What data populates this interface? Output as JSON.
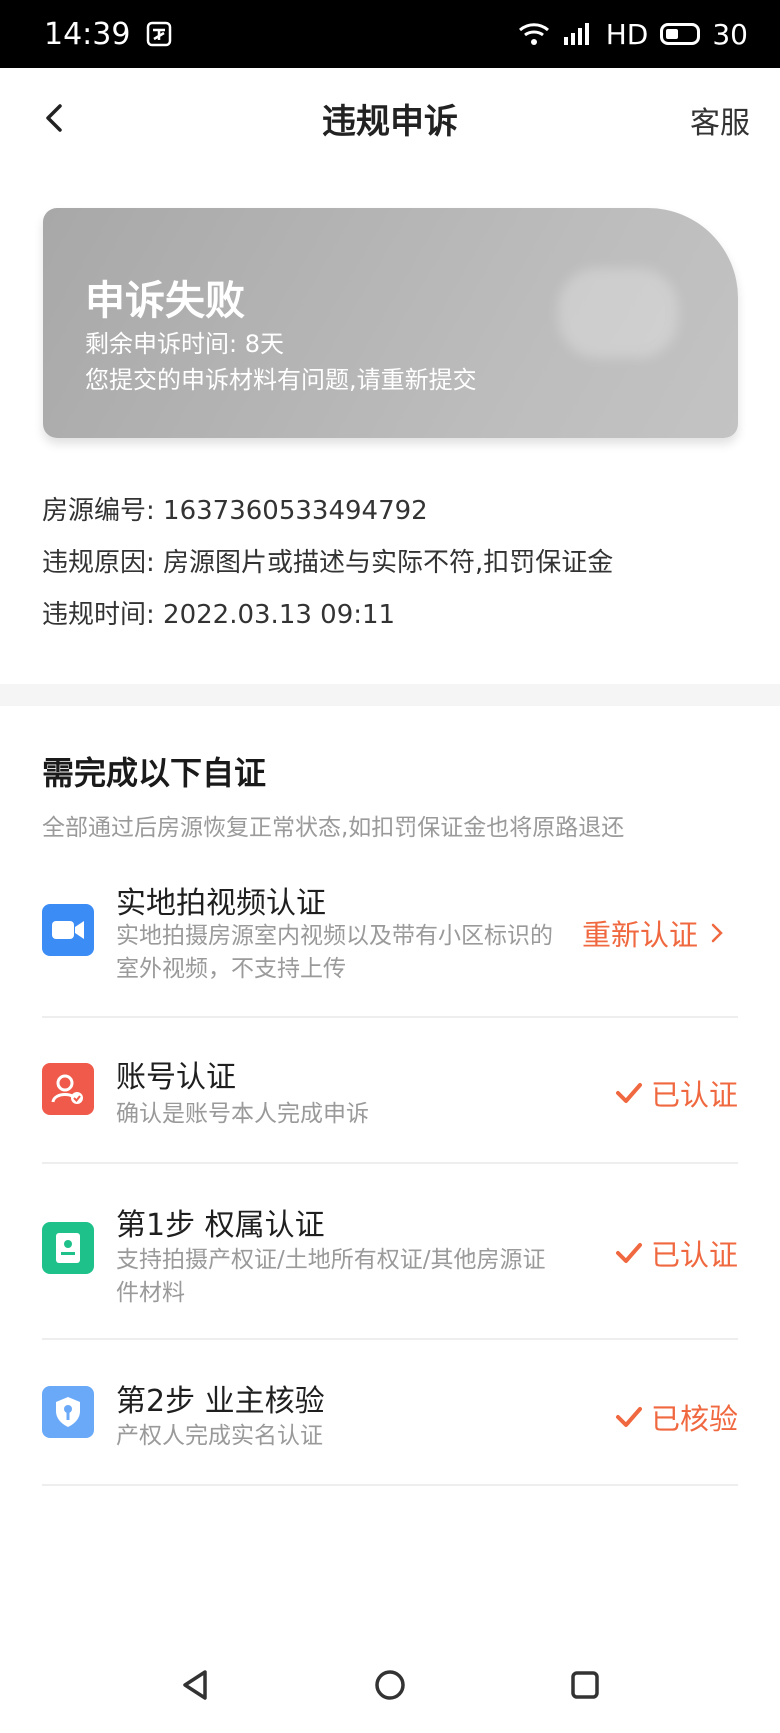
{
  "status_bar": {
    "time": "14:39",
    "network": "HD",
    "battery": "30"
  },
  "nav": {
    "title": "违规申诉",
    "service": "客服"
  },
  "card": {
    "title": "申诉失败",
    "remaining": "剩余申诉时间: 8天",
    "message": "您提交的申诉材料有问题,请重新提交"
  },
  "info": [
    {
      "label": "房源编号:",
      "value": "1637360533494792"
    },
    {
      "label": "违规原因:",
      "value": "房源图片或描述与实际不符,扣罚保证金"
    },
    {
      "label": "违规时间:",
      "value": "2022.03.13 09:11"
    }
  ],
  "verify": {
    "title": "需完成以下自证",
    "subtitle": "全部通过后房源恢复正常状态,如扣罚保证金也将原路退还",
    "items": [
      {
        "title": "实地拍视频认证",
        "desc": "实地拍摄房源室内视频以及带有小区标识的室外视频，不支持上传",
        "status": "重新认证",
        "icon": "video-camera-icon",
        "color": "#3b8cf5"
      },
      {
        "title": "账号认证",
        "desc": "确认是账号本人完成申诉",
        "status": "已认证",
        "icon": "account-icon",
        "color": "#f05a4a"
      },
      {
        "title": "第1步 权属认证",
        "desc": "支持拍摄产权证/土地所有权证/其他房源证件材料",
        "status": "已认证",
        "icon": "certificate-icon",
        "color": "#1fc18a"
      },
      {
        "title": "第2步 业主核验",
        "desc": "产权人完成实名认证",
        "status": "已核验",
        "icon": "shield-key-icon",
        "color": "#6aa9f7"
      }
    ]
  },
  "colors": {
    "accent": "#f0683f",
    "card_gray": "#b4b4b4"
  }
}
